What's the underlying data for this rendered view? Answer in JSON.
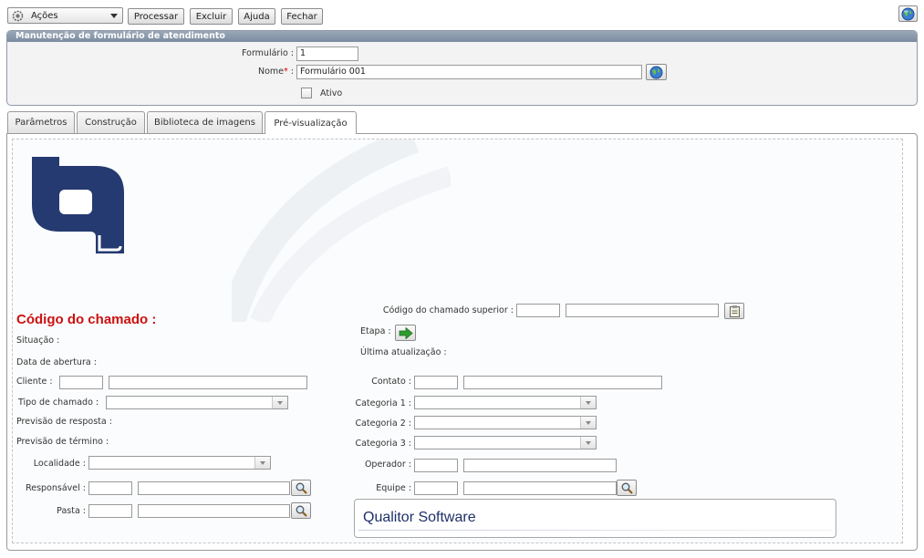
{
  "toolbar": {
    "actions_label": "Ações",
    "process_label": "Processar",
    "delete_label": "Excluir",
    "help_label": "Ajuda",
    "close_label": "Fechar"
  },
  "panel": {
    "title": "Manutenção de formulário de atendimento",
    "form_label": "Formulário :",
    "form_value": "1",
    "name_label": "Nome",
    "name_required": "*",
    "name_colon": ":",
    "name_value": "Formulário 001",
    "active_label": "Ativo",
    "active_checked": false
  },
  "tabs": [
    {
      "label": "Parâmetros",
      "active": false
    },
    {
      "label": "Construção",
      "active": false
    },
    {
      "label": "Biblioteca de imagens",
      "active": false
    },
    {
      "label": "Pré-visualização",
      "active": true
    }
  ],
  "preview": {
    "ticket_code_title": "Código do chamado :",
    "left": {
      "status": "Situação :",
      "open_date": "Data de abertura :",
      "client": "Cliente :",
      "ticket_type": "Tipo de chamado :",
      "response_forecast": "Previsão de resposta :",
      "end_forecast": "Previsão de término :",
      "location": "Localidade :",
      "responsible": "Responsável :",
      "folder": "Pasta :"
    },
    "right": {
      "parent_ticket": "Código do chamado superior :",
      "stage": "Etapa :",
      "last_update": "Última atualização :",
      "contact": "Contato :",
      "category1": "Categoria 1 :",
      "category2": "Categoria 2 :",
      "category3": "Categoria 3 :",
      "operator": "Operador :",
      "team": "Equipe :"
    },
    "footer_brand": "Qualitor Software"
  },
  "colors": {
    "panel_header": "#8595a8",
    "title_red": "#cc1111",
    "brand_blue": "#1e2f68",
    "logo_navy": "#243a70"
  }
}
